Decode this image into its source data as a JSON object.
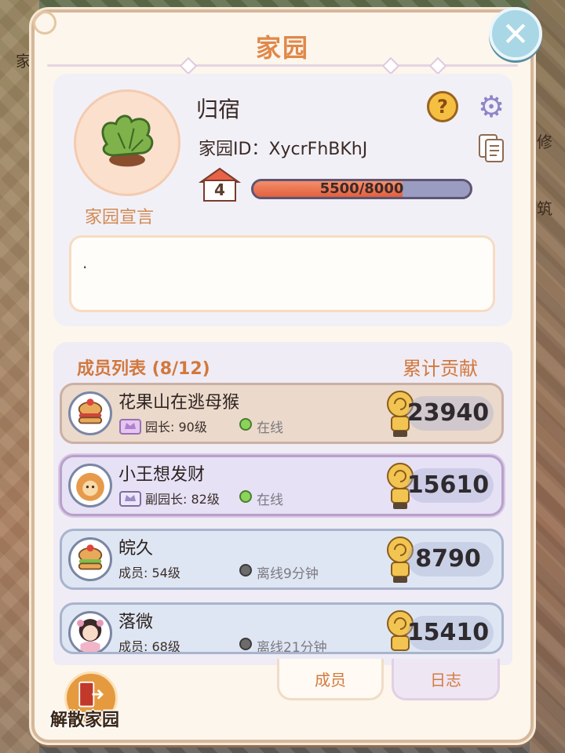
{
  "background": {
    "labels": [
      "家",
      "修",
      "筑"
    ]
  },
  "panel": {
    "title": "家园",
    "close_label": "✕"
  },
  "home": {
    "name": "归宿",
    "id_text": "家园ID：XycrFhBKhJ",
    "level": "4",
    "xp_text": "5500/8000",
    "xp_current": 5500,
    "xp_max": 8000,
    "manifesto_label": "家园宣言",
    "manifesto": "."
  },
  "members": {
    "title": "成员列表 (8/12)",
    "contrib_header": "累计贡献",
    "rows": [
      {
        "name": "花果山在逃母猴",
        "role": "园长: 90级",
        "status": "在线",
        "online": true,
        "contribution": "23940",
        "type": "leader"
      },
      {
        "name": "小王想发财",
        "role": "副园长: 82级",
        "status": "在线",
        "online": true,
        "contribution": "15610",
        "type": "vice"
      },
      {
        "name": "皖久",
        "role": "成员: 54级",
        "status": "离线9分钟",
        "online": false,
        "contribution": "8790",
        "type": "member"
      },
      {
        "name": "落微",
        "role": "成员: 68级",
        "status": "离线21分钟",
        "online": false,
        "contribution": "15410",
        "type": "member"
      }
    ]
  },
  "tabs": {
    "members": "成员",
    "log": "日志"
  },
  "actions": {
    "disband": "解散家园"
  },
  "colors": {
    "accent": "#e0884a",
    "online": "#8ad45b",
    "offline": "#6c6c6c"
  }
}
